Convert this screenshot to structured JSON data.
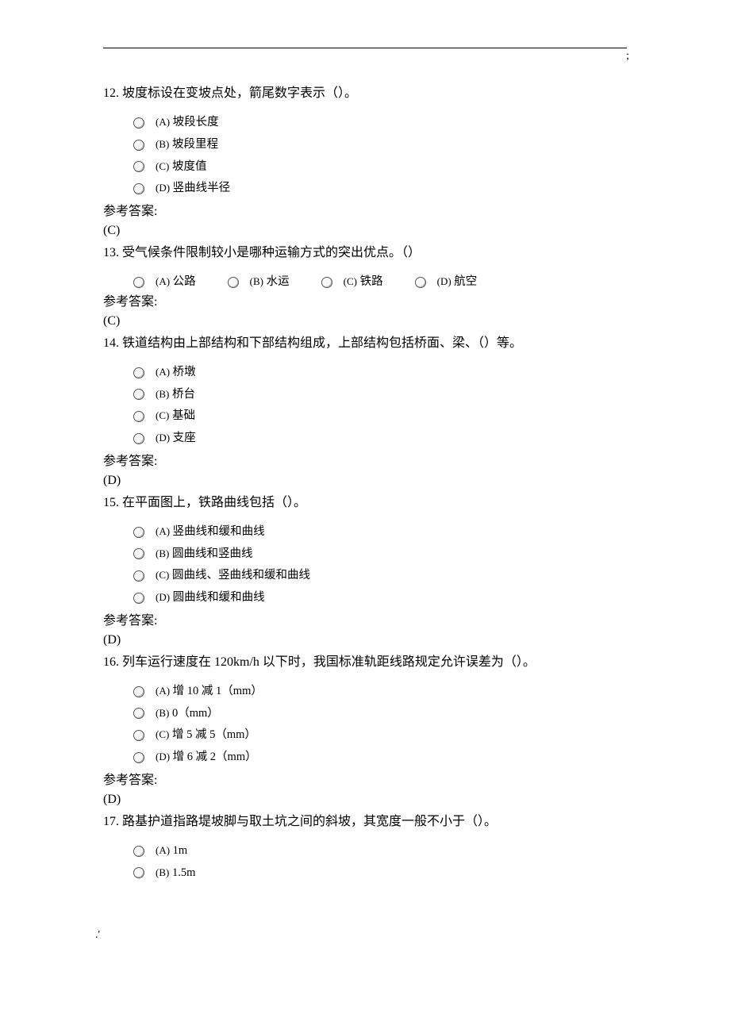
{
  "header": {
    "tick": ";"
  },
  "footer": {
    "mark": ".'"
  },
  "answerLabel": "参考答案:",
  "questions": [
    {
      "num": "12.",
      "text": "坡度标设在变坡点处，箭尾数字表示（）。",
      "layout": "vertical",
      "options": [
        {
          "letter": "(A)",
          "text": "坡段长度"
        },
        {
          "letter": "(B)",
          "text": "坡段里程"
        },
        {
          "letter": "(C)",
          "text": "坡度值"
        },
        {
          "letter": "(D)",
          "text": "竖曲线半径"
        }
      ],
      "answer": "(C)"
    },
    {
      "num": "13.",
      "text": "受气候条件限制较小是哪种运输方式的突出优点。（）",
      "layout": "horizontal",
      "options": [
        {
          "letter": "(A)",
          "text": "公路"
        },
        {
          "letter": "(B)",
          "text": "水运"
        },
        {
          "letter": "(C)",
          "text": "铁路"
        },
        {
          "letter": "(D)",
          "text": "航空"
        }
      ],
      "answer": "(C)"
    },
    {
      "num": "14.",
      "text": "铁道结构由上部结构和下部结构组成，上部结构包括桥面、梁、（）等。",
      "layout": "vertical",
      "options": [
        {
          "letter": "(A)",
          "text": "桥墩"
        },
        {
          "letter": "(B)",
          "text": "桥台"
        },
        {
          "letter": "(C)",
          "text": "基础"
        },
        {
          "letter": "(D)",
          "text": "支座"
        }
      ],
      "answer": "(D)"
    },
    {
      "num": "15.",
      "text": "在平面图上，铁路曲线包括（）。",
      "layout": "vertical",
      "options": [
        {
          "letter": "(A)",
          "text": "竖曲线和缓和曲线"
        },
        {
          "letter": "(B)",
          "text": "圆曲线和竖曲线"
        },
        {
          "letter": "(C)",
          "text": "圆曲线、竖曲线和缓和曲线"
        },
        {
          "letter": "(D)",
          "text": "圆曲线和缓和曲线"
        }
      ],
      "answer": "(D)"
    },
    {
      "num": "16.",
      "text": "列车运行速度在 120km/h 以下时，我国标准轨距线路规定允许误差为（）。",
      "layout": "vertical",
      "options": [
        {
          "letter": "(A)",
          "text": "增 10 减 1（mm）"
        },
        {
          "letter": "(B)",
          "text": "0（mm）"
        },
        {
          "letter": "(C)",
          "text": "增 5 减 5（mm）"
        },
        {
          "letter": "(D)",
          "text": "增 6 减 2（mm）"
        }
      ],
      "answer": "(D)"
    },
    {
      "num": "17.",
      "text": "路基护道指路堤坡脚与取土坑之间的斜坡，其宽度一般不小于（）。",
      "layout": "vertical",
      "options": [
        {
          "letter": "(A)",
          "text": "1m"
        },
        {
          "letter": "(B)",
          "text": "1.5m"
        }
      ],
      "answer": null
    }
  ]
}
